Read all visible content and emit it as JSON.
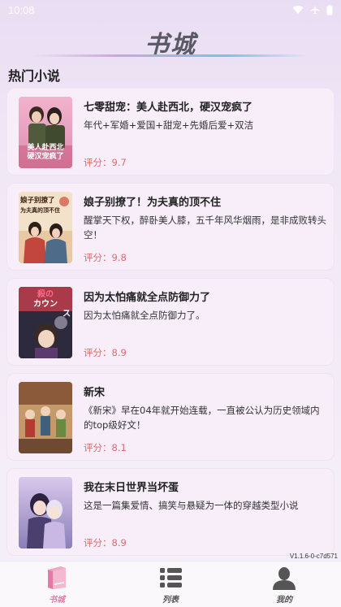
{
  "status_bar": {
    "time": "10:08"
  },
  "header": {
    "title": "书城"
  },
  "section": {
    "title": "热门小说"
  },
  "books": [
    {
      "title": "七零甜宠：美人赴西北，硬汉宠疯了",
      "description": "年代+军婚+爱国+甜宠+先婚后爱+双洁",
      "score": "评分：9.7",
      "cover_text": [
        "美人赴西北",
        "硬汉宠疯了"
      ]
    },
    {
      "title": "娘子别撩了！为夫真的顶不住",
      "description": "醒掌天下权，醉卧美人膝，五千年风华烟雨，是非成败转头空！",
      "score": "评分：9.8",
      "cover_text": [
        "娘子别撩了",
        "为夫真的顶不住"
      ]
    },
    {
      "title": "因为太怕痛就全点防御力了",
      "description": "因为太怕痛就全点防御力了。",
      "score": "评分：8.9",
      "cover_text": [
        "殺の",
        "カウン",
        "ス"
      ]
    },
    {
      "title": "新宋",
      "description": "《新宋》早在04年就开始连载，一直被公认为历史领域内的top级好文！",
      "score": "评分：8.1",
      "cover_text": []
    },
    {
      "title": "我在末日世界当坏蛋",
      "description": "这是一篇集爱情、搞笑与悬疑为一体的穿越类型小说",
      "score": "评分：8.9",
      "cover_text": []
    }
  ],
  "version": "V1.1.6-0-c7d571",
  "tabs": [
    {
      "label": "书城",
      "icon": "book-icon",
      "active": true
    },
    {
      "label": "列表",
      "icon": "list-icon",
      "active": false
    },
    {
      "label": "我的",
      "icon": "user-icon",
      "active": false
    }
  ],
  "colors": {
    "accent": "#e37aa5",
    "score": "#e06b6b",
    "card_bg": "#f7eefa"
  }
}
